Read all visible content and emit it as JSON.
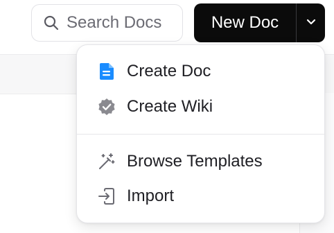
{
  "toolbar": {
    "search_label": "Search Docs",
    "new_doc_label": "New Doc"
  },
  "menu": {
    "items": [
      {
        "label": "Create Doc",
        "icon": "doc-icon"
      },
      {
        "label": "Create Wiki",
        "icon": "verified-badge-icon"
      },
      {
        "label": "Browse Templates",
        "icon": "magic-wand-icon"
      },
      {
        "label": "Import",
        "icon": "import-icon"
      }
    ]
  },
  "colors": {
    "accent_blue": "#1a8cff",
    "primary_button": "#0b0b0b",
    "icon_gray": "#8a8a90"
  }
}
